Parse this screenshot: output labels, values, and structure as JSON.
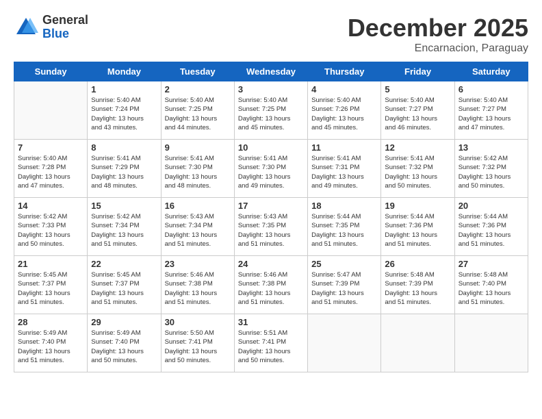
{
  "header": {
    "logo_general": "General",
    "logo_blue": "Blue",
    "month_title": "December 2025",
    "subtitle": "Encarnacion, Paraguay"
  },
  "days_of_week": [
    "Sunday",
    "Monday",
    "Tuesday",
    "Wednesday",
    "Thursday",
    "Friday",
    "Saturday"
  ],
  "weeks": [
    [
      {
        "day": "",
        "info": ""
      },
      {
        "day": "1",
        "info": "Sunrise: 5:40 AM\nSunset: 7:24 PM\nDaylight: 13 hours\nand 43 minutes."
      },
      {
        "day": "2",
        "info": "Sunrise: 5:40 AM\nSunset: 7:25 PM\nDaylight: 13 hours\nand 44 minutes."
      },
      {
        "day": "3",
        "info": "Sunrise: 5:40 AM\nSunset: 7:25 PM\nDaylight: 13 hours\nand 45 minutes."
      },
      {
        "day": "4",
        "info": "Sunrise: 5:40 AM\nSunset: 7:26 PM\nDaylight: 13 hours\nand 45 minutes."
      },
      {
        "day": "5",
        "info": "Sunrise: 5:40 AM\nSunset: 7:27 PM\nDaylight: 13 hours\nand 46 minutes."
      },
      {
        "day": "6",
        "info": "Sunrise: 5:40 AM\nSunset: 7:27 PM\nDaylight: 13 hours\nand 47 minutes."
      }
    ],
    [
      {
        "day": "7",
        "info": "Sunrise: 5:40 AM\nSunset: 7:28 PM\nDaylight: 13 hours\nand 47 minutes."
      },
      {
        "day": "8",
        "info": "Sunrise: 5:41 AM\nSunset: 7:29 PM\nDaylight: 13 hours\nand 48 minutes."
      },
      {
        "day": "9",
        "info": "Sunrise: 5:41 AM\nSunset: 7:30 PM\nDaylight: 13 hours\nand 48 minutes."
      },
      {
        "day": "10",
        "info": "Sunrise: 5:41 AM\nSunset: 7:30 PM\nDaylight: 13 hours\nand 49 minutes."
      },
      {
        "day": "11",
        "info": "Sunrise: 5:41 AM\nSunset: 7:31 PM\nDaylight: 13 hours\nand 49 minutes."
      },
      {
        "day": "12",
        "info": "Sunrise: 5:41 AM\nSunset: 7:32 PM\nDaylight: 13 hours\nand 50 minutes."
      },
      {
        "day": "13",
        "info": "Sunrise: 5:42 AM\nSunset: 7:32 PM\nDaylight: 13 hours\nand 50 minutes."
      }
    ],
    [
      {
        "day": "14",
        "info": "Sunrise: 5:42 AM\nSunset: 7:33 PM\nDaylight: 13 hours\nand 50 minutes."
      },
      {
        "day": "15",
        "info": "Sunrise: 5:42 AM\nSunset: 7:34 PM\nDaylight: 13 hours\nand 51 minutes."
      },
      {
        "day": "16",
        "info": "Sunrise: 5:43 AM\nSunset: 7:34 PM\nDaylight: 13 hours\nand 51 minutes."
      },
      {
        "day": "17",
        "info": "Sunrise: 5:43 AM\nSunset: 7:35 PM\nDaylight: 13 hours\nand 51 minutes."
      },
      {
        "day": "18",
        "info": "Sunrise: 5:44 AM\nSunset: 7:35 PM\nDaylight: 13 hours\nand 51 minutes."
      },
      {
        "day": "19",
        "info": "Sunrise: 5:44 AM\nSunset: 7:36 PM\nDaylight: 13 hours\nand 51 minutes."
      },
      {
        "day": "20",
        "info": "Sunrise: 5:44 AM\nSunset: 7:36 PM\nDaylight: 13 hours\nand 51 minutes."
      }
    ],
    [
      {
        "day": "21",
        "info": "Sunrise: 5:45 AM\nSunset: 7:37 PM\nDaylight: 13 hours\nand 51 minutes."
      },
      {
        "day": "22",
        "info": "Sunrise: 5:45 AM\nSunset: 7:37 PM\nDaylight: 13 hours\nand 51 minutes."
      },
      {
        "day": "23",
        "info": "Sunrise: 5:46 AM\nSunset: 7:38 PM\nDaylight: 13 hours\nand 51 minutes."
      },
      {
        "day": "24",
        "info": "Sunrise: 5:46 AM\nSunset: 7:38 PM\nDaylight: 13 hours\nand 51 minutes."
      },
      {
        "day": "25",
        "info": "Sunrise: 5:47 AM\nSunset: 7:39 PM\nDaylight: 13 hours\nand 51 minutes."
      },
      {
        "day": "26",
        "info": "Sunrise: 5:48 AM\nSunset: 7:39 PM\nDaylight: 13 hours\nand 51 minutes."
      },
      {
        "day": "27",
        "info": "Sunrise: 5:48 AM\nSunset: 7:40 PM\nDaylight: 13 hours\nand 51 minutes."
      }
    ],
    [
      {
        "day": "28",
        "info": "Sunrise: 5:49 AM\nSunset: 7:40 PM\nDaylight: 13 hours\nand 51 minutes."
      },
      {
        "day": "29",
        "info": "Sunrise: 5:49 AM\nSunset: 7:40 PM\nDaylight: 13 hours\nand 50 minutes."
      },
      {
        "day": "30",
        "info": "Sunrise: 5:50 AM\nSunset: 7:41 PM\nDaylight: 13 hours\nand 50 minutes."
      },
      {
        "day": "31",
        "info": "Sunrise: 5:51 AM\nSunset: 7:41 PM\nDaylight: 13 hours\nand 50 minutes."
      },
      {
        "day": "",
        "info": ""
      },
      {
        "day": "",
        "info": ""
      },
      {
        "day": "",
        "info": ""
      }
    ]
  ]
}
